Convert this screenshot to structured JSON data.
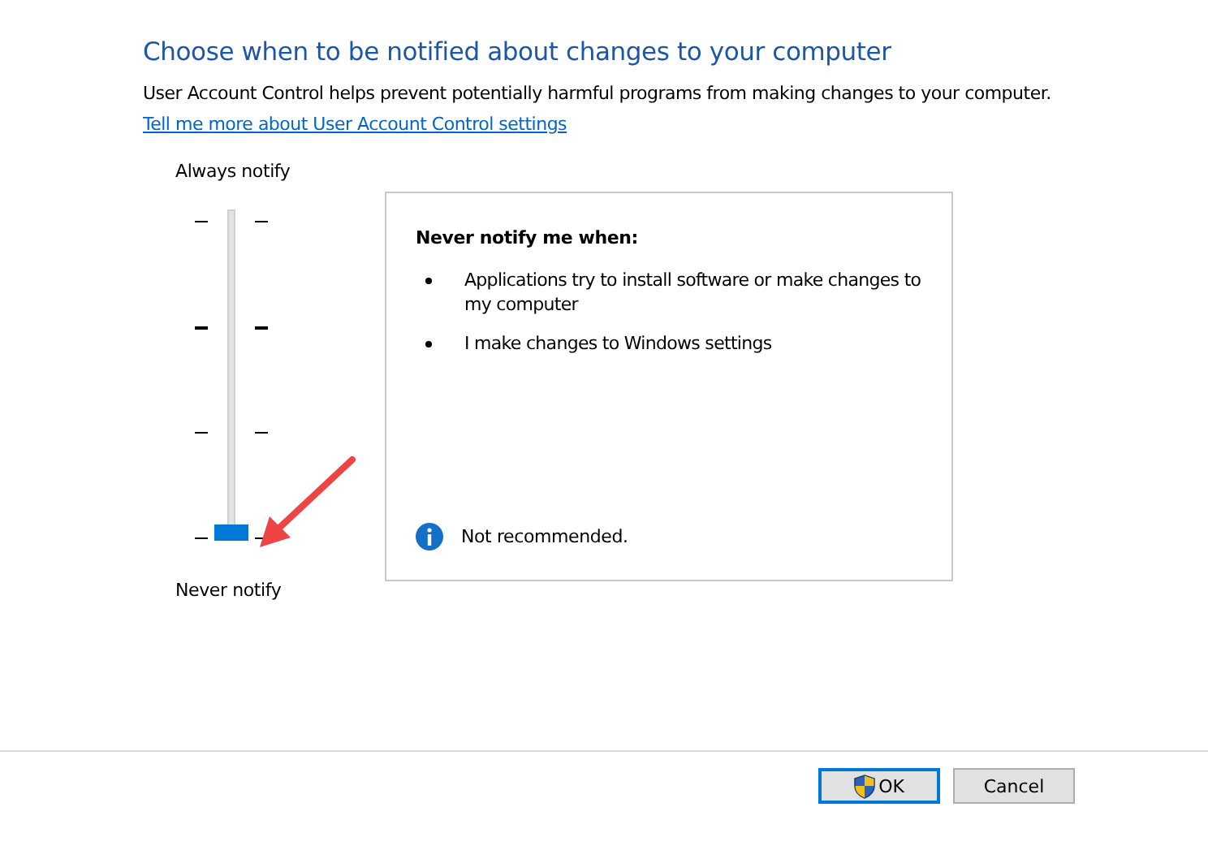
{
  "heading": "Choose when to be notified about changes to your computer",
  "description": "User Account Control helps prevent potentially harmful programs from making changes to your computer.",
  "link": "Tell me more about User Account Control settings",
  "slider": {
    "top_label": "Always notify",
    "bottom_label": "Never notify",
    "level": 0
  },
  "info_box": {
    "title": "Never notify me when:",
    "bullets": [
      "Applications try to install software or make changes to my computer",
      "I make changes to Windows settings"
    ],
    "note": "Not recommended."
  },
  "annotation": {
    "kind": "arrow"
  },
  "buttons": [
    {
      "label": "OK",
      "kind": "shield"
    },
    {
      "label": "Cancel",
      "kind": "plain"
    }
  ]
}
